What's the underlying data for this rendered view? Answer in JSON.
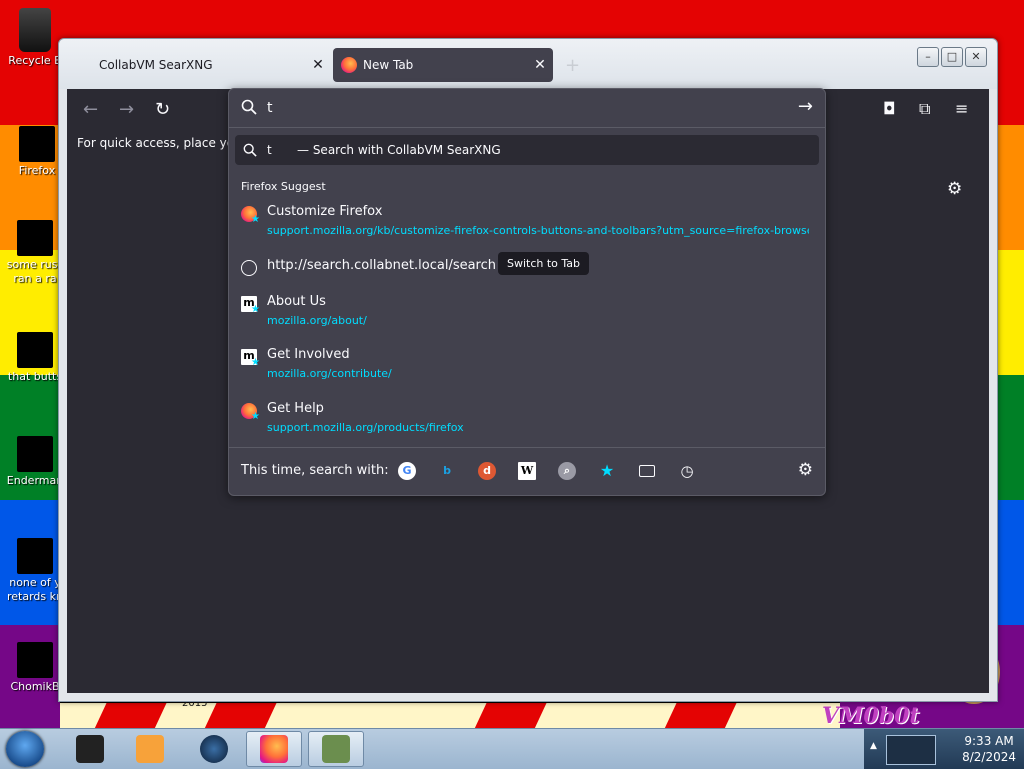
{
  "desktop": {
    "icons": [
      {
        "label": "Recycle B"
      },
      {
        "label": "Firefox"
      },
      {
        "label": "some russ ran a ra"
      },
      {
        "label": "that butts"
      },
      {
        "label": "Enderman"
      },
      {
        "label": "none of y retards kn"
      },
      {
        "label": "ChomikB"
      }
    ],
    "wallpaper_text": "VM0b0t",
    "wallpaper_year": "2015"
  },
  "browser": {
    "tabs": [
      {
        "label": "CollabVM SearXNG",
        "close": "✕"
      },
      {
        "label": "New Tab",
        "close": "✕"
      }
    ],
    "new_tab_symbol": "+",
    "window_buttons": {
      "minimize": "–",
      "maximize": "□",
      "close": "✕"
    },
    "bookmarks_hint": "For quick access, place your b"
  },
  "urlbar": {
    "typed": "t",
    "heuristic": {
      "query": "t",
      "action": "— Search with CollabVM SearXNG"
    },
    "group_label": "Firefox Suggest",
    "results": [
      {
        "title": "Customize Firefox",
        "url": "support.mozilla.org/kb/customize-firefox-controls-buttons-and-toolbars?utm_source=firefox-browser&utm_medium=default-bookmarks",
        "icon": "firefox-icon"
      },
      {
        "title": "http://search.collabnet.local/search",
        "url": "",
        "icon": "globe-icon",
        "button": "Switch to Tab"
      },
      {
        "title": "About Us",
        "url": "mozilla.org/about/",
        "icon": "mozilla-icon"
      },
      {
        "title": "Get Involved",
        "url": "mozilla.org/contribute/",
        "icon": "mozilla-icon"
      },
      {
        "title": "Get Help",
        "url": "support.mozilla.org/products/firefox",
        "icon": "firefox-icon"
      }
    ],
    "footer_label": "This time, search with:",
    "engines": [
      "google-icon",
      "bing-icon",
      "duckduckgo-icon",
      "wikipedia-icon",
      "searxng-icon",
      "bookmarks-icon",
      "tabs-icon",
      "history-icon"
    ]
  },
  "taskbar": {
    "time": "9:33 AM",
    "date": "8/2/2024"
  },
  "colors": {
    "accent": "#00ddff",
    "panel": "#42414d",
    "toolbar": "#2b2a33"
  }
}
